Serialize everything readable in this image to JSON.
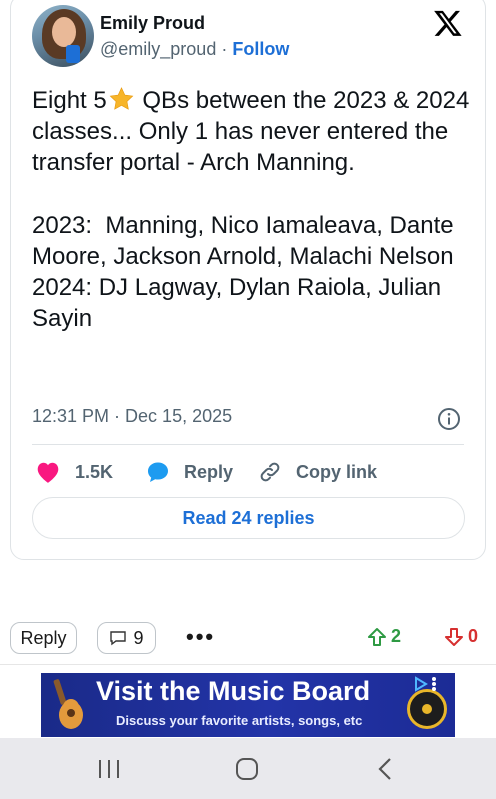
{
  "tweet": {
    "author_name": "Emily Proud",
    "author_handle": "@emily_proud",
    "separator": " · ",
    "follow_label": "Follow",
    "text_part1": "Eight 5",
    "text_part2": " QBs between the 2023 & 2024 classes... Only 1 has never entered the transfer portal - Arch Manning.\n\n2023:  Manning, Nico Iamaleava, Dante Moore, Jackson Arnold, Malachi Nelson\n2024: DJ Lagway, Dylan Raiola, Julian Sayin",
    "timestamp": "12:31 PM · Dec 15, 2025",
    "likes": "1.5K",
    "reply_label": "Reply",
    "copy_link_label": "Copy link",
    "read_replies_label": "Read 24 replies"
  },
  "comment_bar": {
    "reply_label": "Reply",
    "comment_count": "9",
    "more_label": "•••",
    "upvotes": "2",
    "downvotes": "0"
  },
  "ad": {
    "title": "Visit the Music Board",
    "subtitle": "Discuss your favorite artists, songs, etc"
  },
  "colors": {
    "accent_blue": "#1d6fd6",
    "like_pink": "#f91880",
    "upvote_green": "#2e9a43",
    "downvote_red": "#d63030",
    "ad_background": "#2334a8"
  },
  "icons": [
    "x-logo-icon",
    "star-icon",
    "info-icon",
    "heart-icon",
    "speech-bubble-icon",
    "link-icon",
    "comment-icon",
    "arrow-up-icon",
    "arrow-down-icon",
    "guitar-icon",
    "adchoices-icon",
    "recents-icon",
    "home-icon",
    "back-icon"
  ]
}
